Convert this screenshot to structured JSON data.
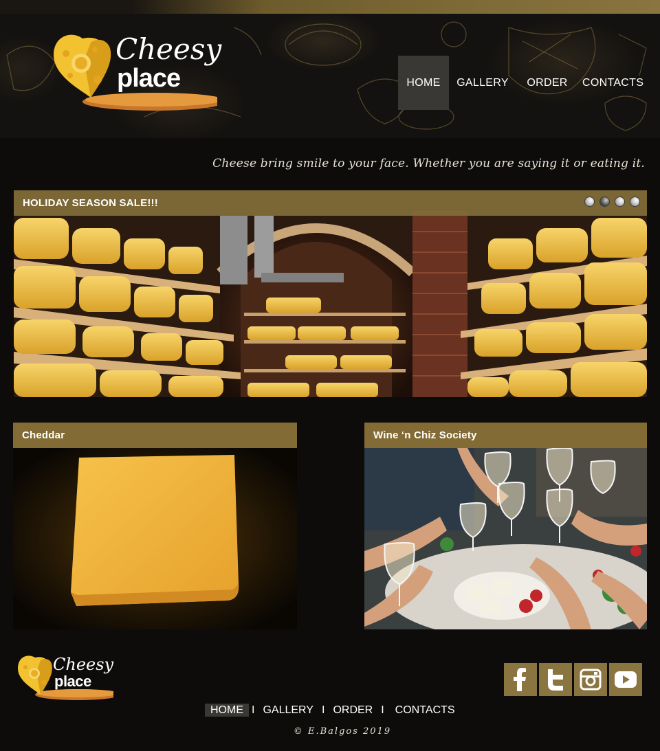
{
  "brand": {
    "logo_line1": "Cheesy",
    "logo_line2": "place"
  },
  "nav": {
    "items": [
      {
        "label": "HOME",
        "active": true
      },
      {
        "label": "GALLERY",
        "active": false
      },
      {
        "label": "ORDER",
        "active": false
      },
      {
        "label": "CONTACTS",
        "active": false
      }
    ]
  },
  "tagline": "Cheese bring smile to your face. Whether you are saying it or eating it.",
  "slider": {
    "title": "HOLIDAY SEASON SALE!!!",
    "slide_count": 4,
    "active_slide": 2,
    "image": "cheese-cellar-photo"
  },
  "cards": [
    {
      "title": "Cheddar",
      "image": "cheddar-block-photo"
    },
    {
      "title": "Wine ‘n Chiz Society",
      "image": "wine-toast-photo"
    }
  ],
  "footer": {
    "social": [
      "facebook-icon",
      "twitter-icon",
      "instagram-icon",
      "youtube-icon"
    ],
    "nav": [
      {
        "label": "HOME",
        "active": true
      },
      {
        "label": "GALLERY",
        "active": false
      },
      {
        "label": "ORDER",
        "active": false
      },
      {
        "label": "CONTACTS",
        "active": false
      }
    ],
    "separator": "I",
    "copyright": "© E.Balgos 2019"
  },
  "colors": {
    "background": "#0d0c0b",
    "accent_gold": "#836b35",
    "nav_active": "#3a3835",
    "cheese_yellow": "#f2c230"
  }
}
